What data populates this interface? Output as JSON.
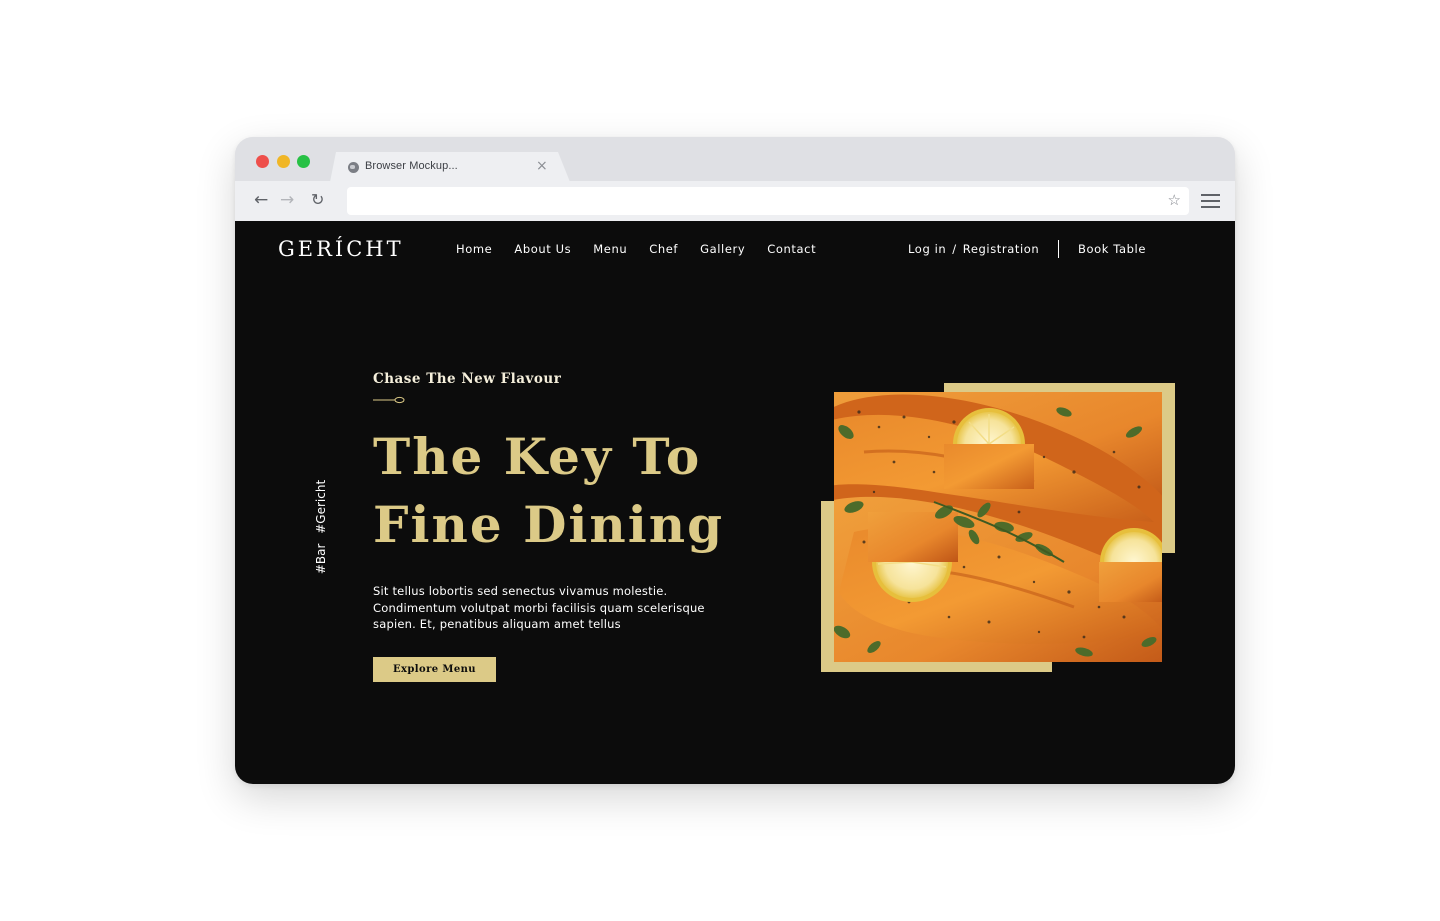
{
  "browser": {
    "tab_title": "Browser Mockup...",
    "tab_close": "×",
    "back_icon": "←",
    "forward_icon": "→",
    "reload_icon": "↻",
    "star_icon": "☆",
    "url": ""
  },
  "site": {
    "logo": "GERÍCHT",
    "nav": [
      "Home",
      "About Us",
      "Menu",
      "Chef",
      "Gallery",
      "Contact"
    ],
    "login": "Log in",
    "slash": "/",
    "registration": "Registration",
    "book_table": "Book Table",
    "tags": [
      "#Bar",
      "#Gericht"
    ],
    "hero": {
      "subtitle": "Chase The New Flavour",
      "headline_line1": "The Key To",
      "headline_line2": "Fine Dining",
      "description": "Sit tellus lobortis sed senectus vivamus molestie. Condimentum volutpat morbi facilisis quam scelerisque sapien. Et, penatibus aliquam amet tellus",
      "cta": "Explore Menu"
    }
  },
  "colors": {
    "gold": "#dcca87",
    "background": "#0c0c0c",
    "text": "#ffffff"
  }
}
